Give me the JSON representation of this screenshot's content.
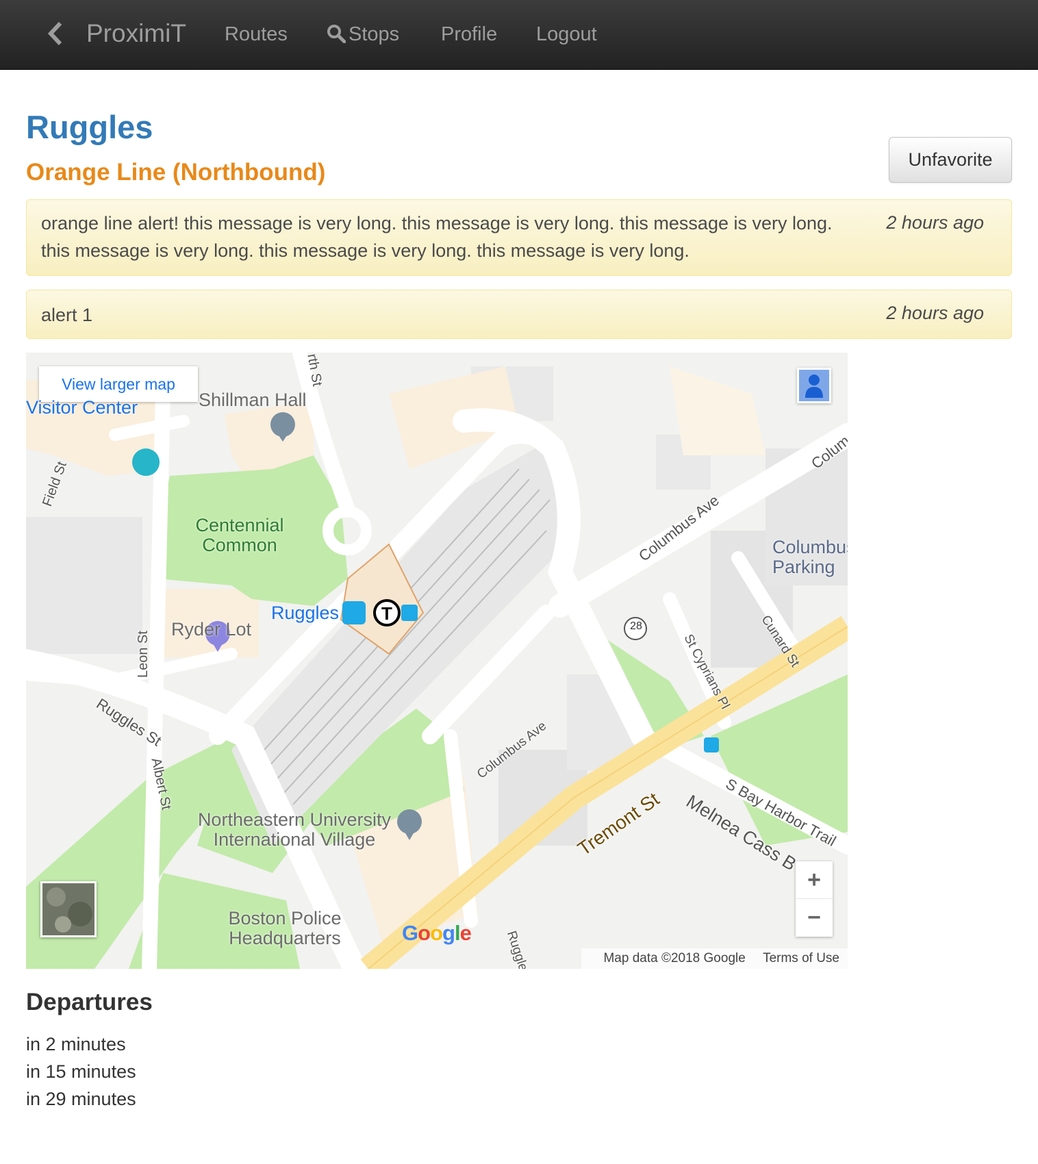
{
  "nav": {
    "brand": "ProximiT",
    "routes": "Routes",
    "stops": "Stops",
    "profile": "Profile",
    "logout": "Logout"
  },
  "stop": {
    "name": "Ruggles",
    "route": "Orange Line (Northbound)",
    "favorite_button": "Unfavorite"
  },
  "alerts": [
    {
      "message": "orange line alert! this message is very long. this message is very long. this message is very long. this message is very long. this message is very long. this message is very long.",
      "time": "2 hours ago"
    },
    {
      "message": "alert 1",
      "time": "2 hours ago"
    }
  ],
  "map": {
    "view_larger": "View larger map",
    "labels": {
      "visitor_center": "Visitor Center",
      "shillman_hall": "Shillman Hall",
      "centennial_common": "Centennial Common",
      "ryder_lot": "Ryder Lot",
      "ruggles": "Ruggles",
      "columbus_parking": "Columbus Parking",
      "northeastern": "Northeastern University International Village",
      "boston_police": "Boston Police Headquarters",
      "columbus_ave": "Columbus Ave",
      "columbus_ave_2": "Columbus Ave",
      "colum": "Colum",
      "ruggles_st": "Ruggles St",
      "leon_st": "Leon St",
      "albert_st": "Albert St",
      "field_st": "Field St",
      "forsyth_st": "rth St",
      "tremont_st": "Tremont St",
      "melnea_cass": "Melnea Cass B",
      "s_bay_harbor": "S Bay Harbor Trail",
      "st_cyprians": "St Cyprians Pl",
      "cunard_st": "Cunard St",
      "route_28": "28",
      "ruggles_bottom": "Ruggle"
    },
    "footer_data": "Map data ©2018 Google",
    "footer_terms": "Terms of Use",
    "zoom_in": "+",
    "zoom_out": "−"
  },
  "departures": {
    "heading": "Departures",
    "items": [
      "in 2 minutes",
      "in 15 minutes",
      "in 29 minutes"
    ]
  },
  "colors": {
    "navbar": "#222222",
    "link_blue": "#337ab7",
    "route_orange": "#e8891a",
    "alert_bg": "#fcf8e3"
  }
}
